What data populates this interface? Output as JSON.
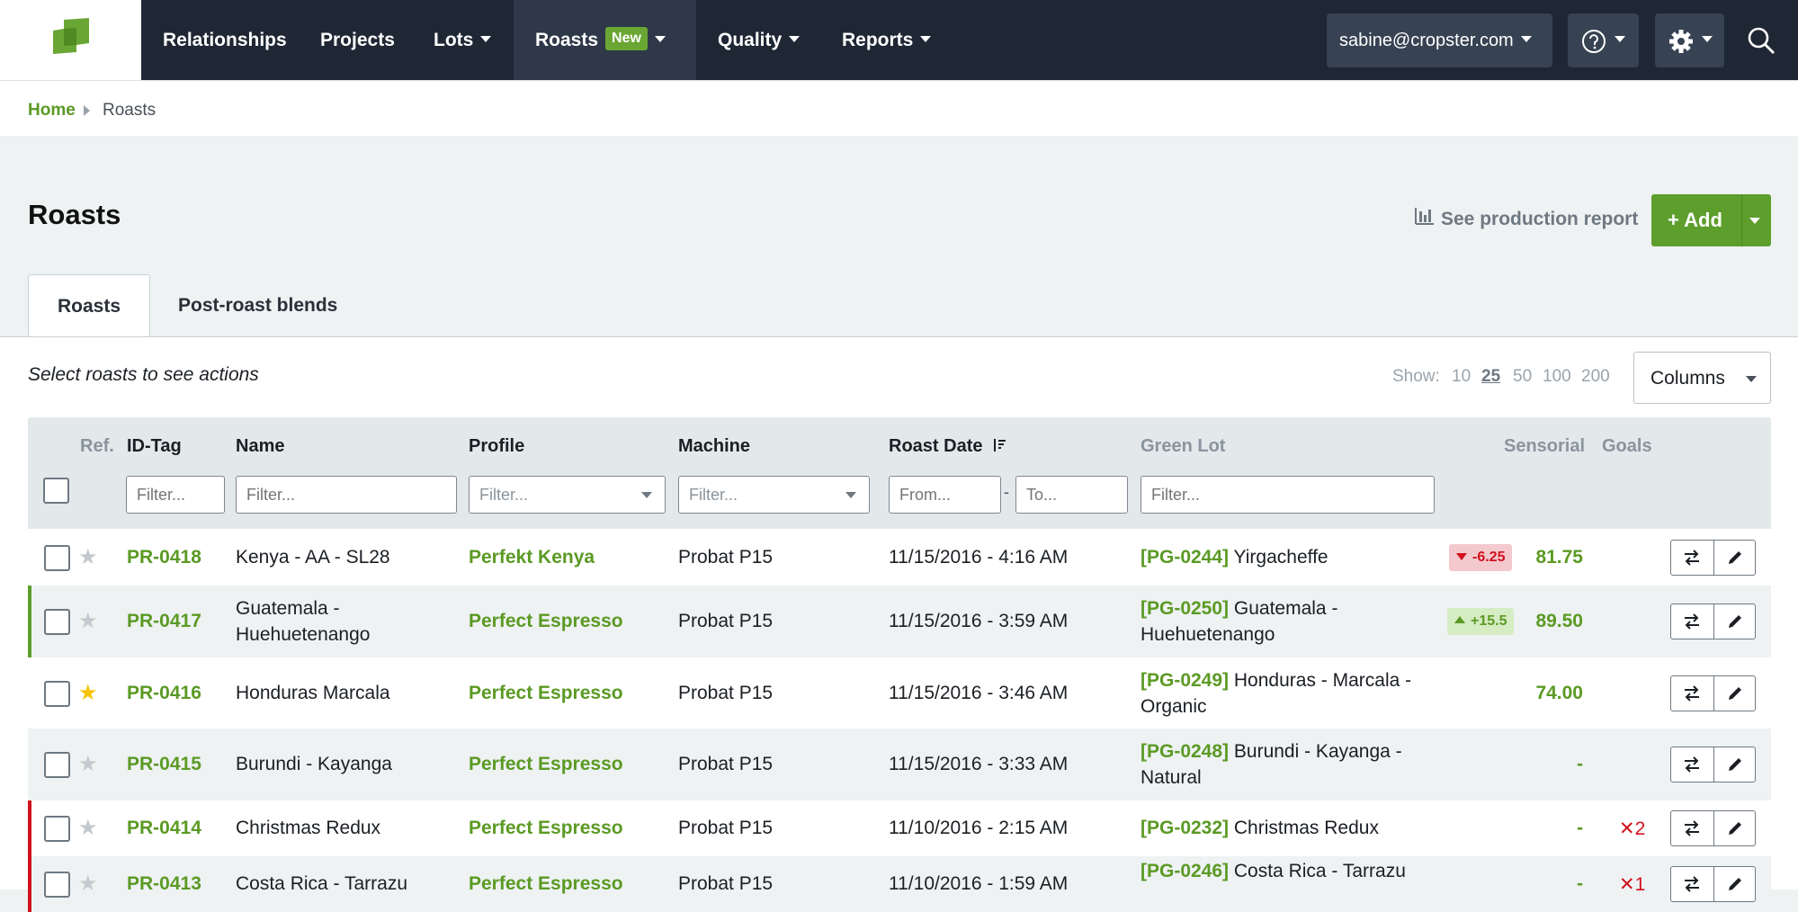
{
  "nav": {
    "items": [
      {
        "label": "Relationships"
      },
      {
        "label": "Projects"
      },
      {
        "label": "Lots"
      },
      {
        "label": "Roasts",
        "badge": "New"
      },
      {
        "label": "Quality"
      },
      {
        "label": "Reports"
      }
    ],
    "user_email": "sabine@cropster.com",
    "icons": [
      "help-icon",
      "gear-icon",
      "search-icon"
    ]
  },
  "breadcrumb": {
    "home": "Home",
    "current": "Roasts"
  },
  "page": {
    "title": "Roasts",
    "production_report_link": "See production report",
    "add_button": "+ Add"
  },
  "tabs": [
    {
      "label": "Roasts",
      "active": true
    },
    {
      "label": "Post-roast blends",
      "active": false
    }
  ],
  "toolbar": {
    "hint": "Select roasts to see actions",
    "show_label": "Show:",
    "page_sizes": [
      "10",
      "25",
      "50",
      "100",
      "200"
    ],
    "page_size_selected": "25",
    "columns_button": "Columns"
  },
  "table": {
    "headers": {
      "ref": "Ref.",
      "id_tag": "ID-Tag",
      "name": "Name",
      "profile": "Profile",
      "machine": "Machine",
      "roast_date": "Roast Date",
      "green_lot": "Green Lot",
      "sensorial": "Sensorial",
      "goals": "Goals"
    },
    "filters": {
      "id_tag": "Filter...",
      "name": "Filter...",
      "profile": "Filter...",
      "machine": "Filter...",
      "date_from": "From...",
      "date_to": "To...",
      "green_lot": "Filter..."
    },
    "date_separator": "-",
    "rows": [
      {
        "starred": false,
        "id_tag": "PR-0418",
        "name": "Kenya - AA - SL28",
        "profile": "Perfekt Kenya",
        "machine": "Probat P15",
        "roast_date": "11/15/2016 - 4:16 AM",
        "lot_ref": "[PG-0244]",
        "lot_name": "Yirgacheffe",
        "delta": "-6.25",
        "delta_dir": "down",
        "score": "81.75",
        "goal": "",
        "status_color": ""
      },
      {
        "starred": false,
        "id_tag": "PR-0417",
        "name": "Guatemala - Huehuetenango",
        "profile": "Perfect Espresso",
        "machine": "Probat P15",
        "roast_date": "11/15/2016 - 3:59 AM",
        "lot_ref": "[PG-0250]",
        "lot_name": "Guatemala - Huehuetenango",
        "delta": "+15.5",
        "delta_dir": "up",
        "score": "89.50",
        "goal": "",
        "status_color": "#5d9e2c"
      },
      {
        "starred": true,
        "id_tag": "PR-0416",
        "name": "Honduras Marcala",
        "profile": "Perfect Espresso",
        "machine": "Probat P15",
        "roast_date": "11/15/2016 - 3:46 AM",
        "lot_ref": "[PG-0249]",
        "lot_name": "Honduras - Marcala - Organic",
        "delta": "",
        "delta_dir": "",
        "score": "74.00",
        "goal": "",
        "status_color": ""
      },
      {
        "starred": false,
        "id_tag": "PR-0415",
        "name": "Burundi - Kayanga",
        "profile": "Perfect Espresso",
        "machine": "Probat P15",
        "roast_date": "11/15/2016 - 3:33 AM",
        "lot_ref": "[PG-0248]",
        "lot_name": "Burundi - Kayanga - Natural",
        "delta": "",
        "delta_dir": "",
        "score": "-",
        "goal": "",
        "status_color": ""
      },
      {
        "starred": false,
        "id_tag": "PR-0414",
        "name": "Christmas Redux",
        "profile": "Perfect Espresso",
        "machine": "Probat P15",
        "roast_date": "11/10/2016 - 2:15 AM",
        "lot_ref": "[PG-0232]",
        "lot_name": "Christmas Redux",
        "delta": "",
        "delta_dir": "",
        "score": "-",
        "goal": "✕2",
        "status_color": "#d0111d"
      },
      {
        "starred": false,
        "id_tag": "PR-0413",
        "name": "Costa Rica - Tarrazu",
        "profile": "Perfect Espresso",
        "machine": "Probat P15",
        "roast_date": "11/10/2016 - 1:59 AM",
        "lot_ref": "[PG-0246]",
        "lot_name": "Costa Rica - Tarrazu",
        "delta": "",
        "delta_dir": "",
        "score": "-",
        "goal": "✕1",
        "status_color": "#d0111d"
      }
    ]
  },
  "colors": {
    "brand_green": "#5d9e2c",
    "nav_bg": "#1f2735",
    "negative": "#d0111d"
  }
}
